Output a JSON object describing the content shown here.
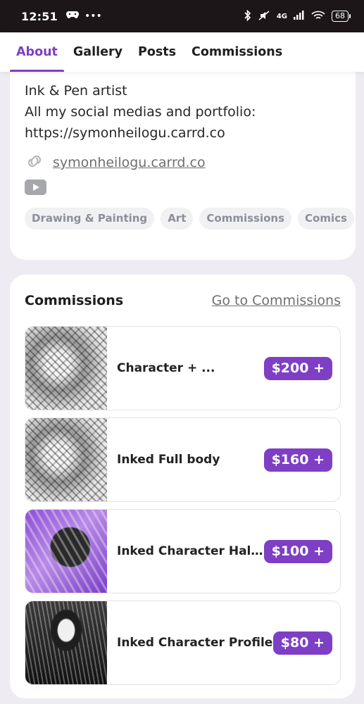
{
  "status_bar": {
    "time": "12:51",
    "left_icons": [
      "game-controller-icon",
      "more-dots-icon"
    ],
    "network": "4G",
    "battery": "68"
  },
  "tabs": [
    {
      "label": "About",
      "active": true
    },
    {
      "label": "Gallery",
      "active": false
    },
    {
      "label": "Posts",
      "active": false
    },
    {
      "label": "Commissions",
      "active": false
    }
  ],
  "about": {
    "bio": [
      "Ink & Pen artist",
      "All my social medias and portfolio:",
      "https://symonheilogu.carrd.co"
    ],
    "link": "symonheilogu.carrd.co",
    "tags": [
      "Drawing & Painting",
      "Art",
      "Commissions",
      "Comics"
    ]
  },
  "commissions": {
    "title": "Commissions",
    "go_link": "Go to Commissions",
    "items": [
      {
        "name": "Character + ...",
        "price": "$200 +",
        "thumb": "gray"
      },
      {
        "name": "Inked Full body",
        "price": "$160 +",
        "thumb": "gray"
      },
      {
        "name": "Inked Character Half ...",
        "price": "$100 +",
        "thumb": "purple"
      },
      {
        "name": "Inked Character Profile",
        "price": "$80 +",
        "thumb": "dark"
      }
    ]
  },
  "colors": {
    "accent": "#7e3fc5",
    "background": "#eeebf3",
    "tag_bg": "#f1f1f4"
  }
}
